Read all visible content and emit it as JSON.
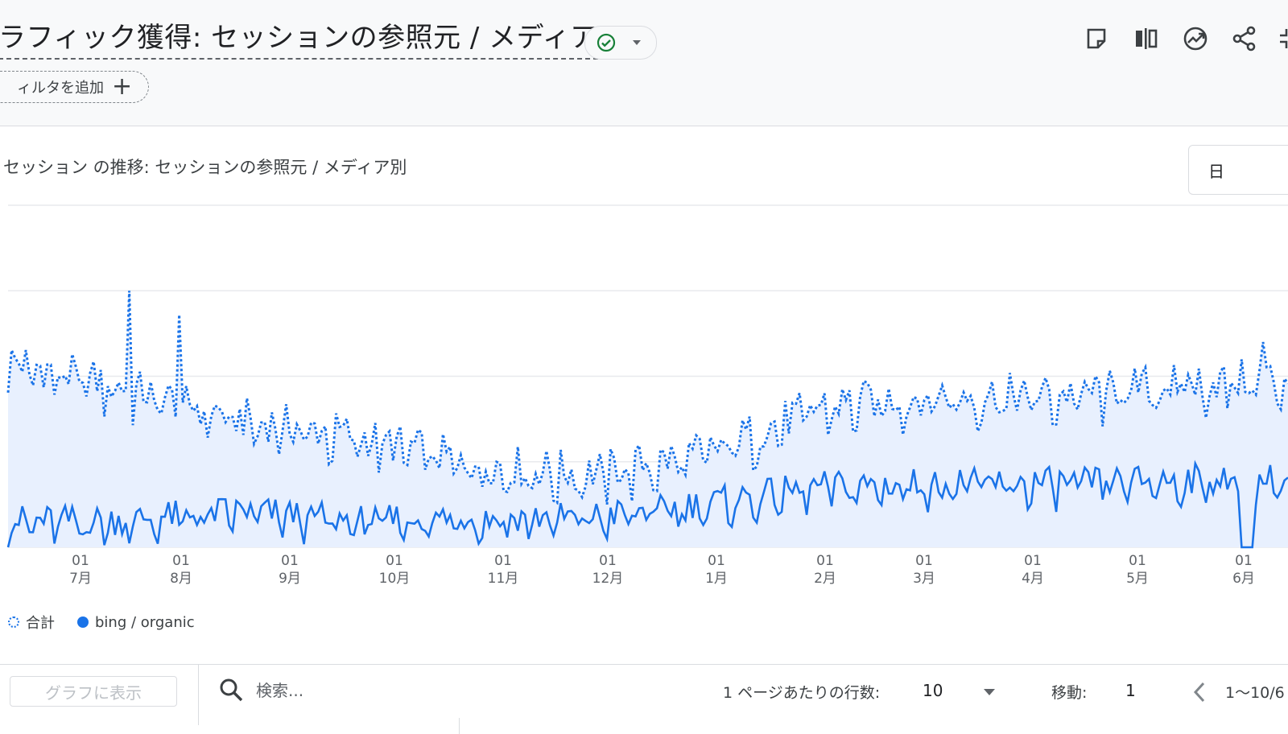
{
  "header": {
    "title": "ラフィック獲得: セッションの参照元 / メディア",
    "status_icon": "check-circle-icon",
    "toolbar_icons": [
      "note-icon",
      "compare-icon",
      "insights-icon",
      "share-icon",
      "collapse-icon"
    ],
    "filter_label": "ィルタを追加",
    "filter_plus": "+"
  },
  "chart_card": {
    "title": "セッション の推移: セッションの参照元 / メディア別",
    "granularity": "日"
  },
  "chart_data": {
    "type": "line",
    "x_ticks": [
      {
        "top": "01",
        "bottom": "7月"
      },
      {
        "top": "01",
        "bottom": "8月"
      },
      {
        "top": "01",
        "bottom": "9月"
      },
      {
        "top": "01",
        "bottom": "10月"
      },
      {
        "top": "01",
        "bottom": "11月"
      },
      {
        "top": "01",
        "bottom": "12月"
      },
      {
        "top": "01",
        "bottom": "1月"
      },
      {
        "top": "01",
        "bottom": "2月"
      },
      {
        "top": "01",
        "bottom": "3月"
      },
      {
        "top": "01",
        "bottom": "4月"
      },
      {
        "top": "01",
        "bottom": "5月"
      },
      {
        "top": "01",
        "bottom": "6月"
      }
    ],
    "y_gridlines": 4,
    "y_tick_labels_visible": false,
    "series": [
      {
        "name": "合計",
        "style": "dotted",
        "color": "#1a73e8",
        "approx_level_by_month": [
          0.55,
          0.47,
          0.38,
          0.33,
          0.25,
          0.22,
          0.28,
          0.42,
          0.45,
          0.45,
          0.48,
          0.5
        ],
        "peaks": [
          0.75,
          0.68,
          0.6
        ]
      },
      {
        "name": "bing / organic",
        "style": "solid",
        "color": "#1a73e8",
        "approx_level_by_month": [
          0.08,
          0.08,
          0.11,
          0.08,
          0.09,
          0.09,
          0.13,
          0.18,
          0.19,
          0.19,
          0.2,
          0.2
        ]
      }
    ],
    "area_fill": "#e8f0fe",
    "legend_position": "bottom-left"
  },
  "legend": {
    "total_label": "合計",
    "bing_label": "bing / organic"
  },
  "table_controls": {
    "plot_button": "グラフに表示",
    "search_placeholder": "検索...",
    "rows_per_page_label": "1 ページあたりの行数:",
    "rows_per_page_value": "10",
    "goto_label": "移動:",
    "goto_value": "1",
    "range_label": "1〜10/6"
  }
}
